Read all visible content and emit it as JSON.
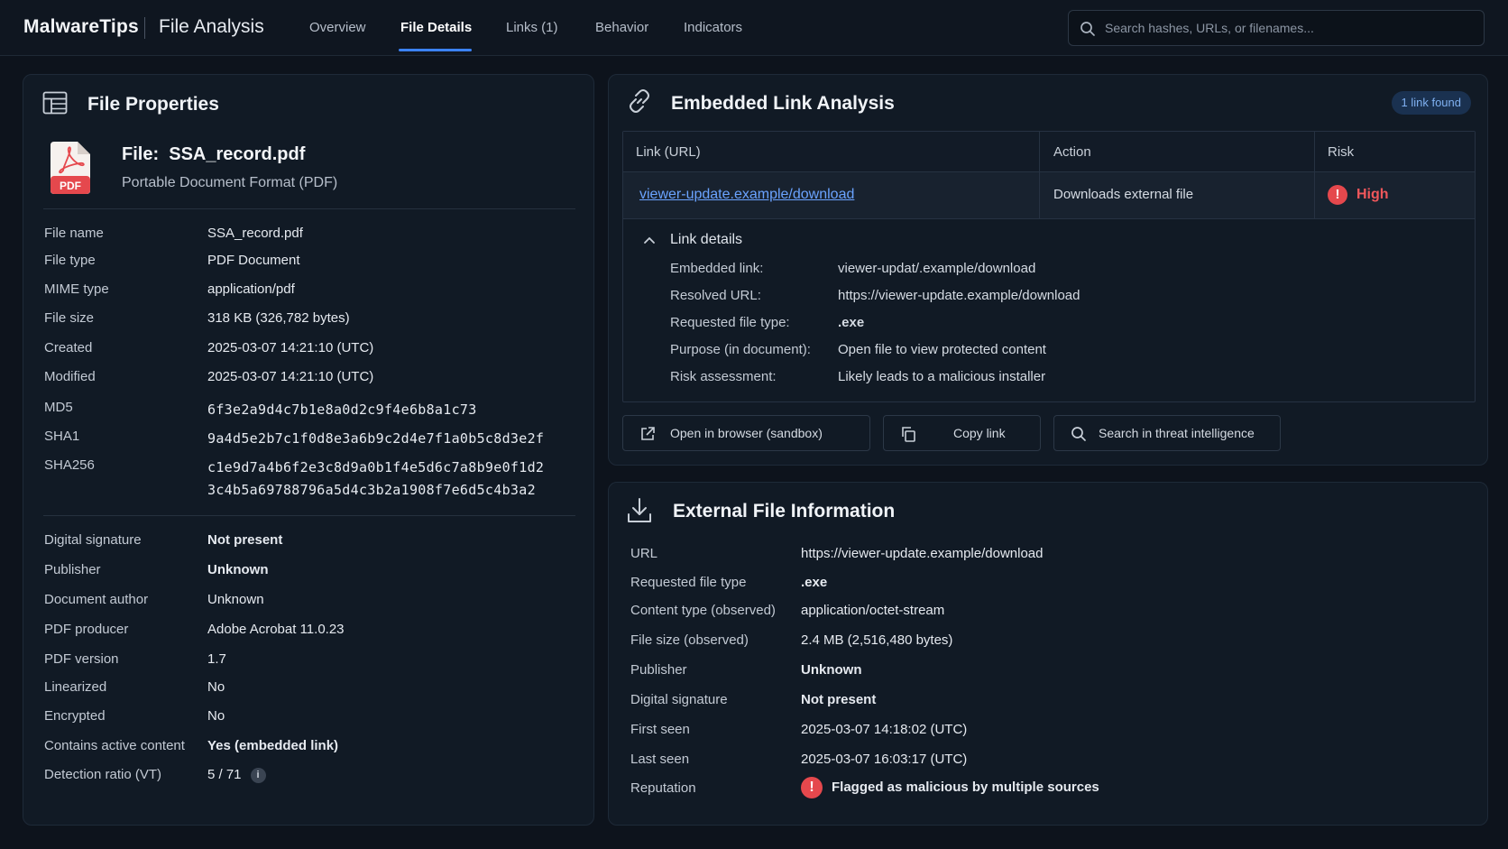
{
  "header": {
    "brand": "MalwareTips",
    "section": "File Analysis",
    "tabs": [
      "Overview",
      "File Details",
      "Links (1)",
      "Behavior",
      "Indicators"
    ],
    "active_tab": "File Details",
    "search_placeholder": "Search hashes, URLs, or filenames..."
  },
  "file_properties": {
    "title": "File Properties",
    "file_label": "File:",
    "file_name": "SSA_record.pdf",
    "file_format": "Portable Document Format (PDF)",
    "pdf_icon_text": "PDF",
    "rows": [
      {
        "label": "File name",
        "value": "SSA_record.pdf"
      },
      {
        "label": "File type",
        "value": "PDF Document"
      },
      {
        "label": "MIME type",
        "value": "application/pdf"
      },
      {
        "label": "File size",
        "value": "318 KB (326,782 bytes)"
      },
      {
        "label": "Created",
        "value": "2025-03-07 14:21:10 (UTC)"
      },
      {
        "label": "Modified",
        "value": "2025-03-07 14:21:10 (UTC)"
      }
    ],
    "hashes": [
      {
        "label": "MD5",
        "value": "6f3e2a9d4c7b1e8a0d2c9f4e6b8a1c73"
      },
      {
        "label": "SHA1",
        "value": "9a4d5e2b7c1f0d8e3a6b9c2d4e7f1a0b5c8d3e2f"
      },
      {
        "label": "SHA256",
        "value_line1": "c1e9d7a4b6f2e3c8d9a0b1f4e5d6c7a8b9e0f1d2",
        "value_line2": "3c4b5a69788796a5d4c3b2a1908f7e6d5c4b3a2"
      }
    ],
    "meta": [
      {
        "label": "Digital signature",
        "value": "Not present"
      },
      {
        "label": "Publisher",
        "value": "Unknown"
      },
      {
        "label": "Document author",
        "value": "Unknown"
      },
      {
        "label": "PDF producer",
        "value": "Adobe Acrobat 11.0.23"
      },
      {
        "label": "PDF version",
        "value": "1.7"
      },
      {
        "label": "Linearized",
        "value": "No"
      },
      {
        "label": "Encrypted",
        "value": "No"
      },
      {
        "label": "Contains active content",
        "value": "Yes (embedded link)"
      },
      {
        "label": "Detection ratio (VT)",
        "value": "5 / 71"
      }
    ],
    "info_glyph": "i"
  },
  "link_analysis": {
    "title": "Embedded Link Analysis",
    "badge": "1 link found",
    "columns": [
      "Link (URL)",
      "Action",
      "Risk"
    ],
    "link": {
      "url": "viewer-update.example/download",
      "action": "Downloads external file",
      "risk": "High",
      "risk_glyph": "!"
    },
    "details_header": "Link details",
    "details": [
      {
        "label": "Embedded link:",
        "value": "viewer-updat/.example/download"
      },
      {
        "label": "Resolved URL:",
        "value": "https://viewer-update.example/download"
      },
      {
        "label": "Requested file type:",
        "value": ".exe"
      },
      {
        "label": "Purpose (in document):",
        "value": "Open file to view protected content"
      },
      {
        "label": "Risk assessment:",
        "value": "Likely leads to a malicious installer"
      }
    ],
    "buttons": [
      "Open in browser (sandbox)",
      "Copy link",
      "Search in threat intelligence"
    ]
  },
  "external_file": {
    "title": "External File Information",
    "rows": [
      {
        "label": "URL",
        "value": "https://viewer-update.example/download"
      },
      {
        "label": "Requested file type",
        "value": ".exe"
      },
      {
        "label": "Content type (observed)",
        "value": "application/octet-stream"
      },
      {
        "label": "File size (observed)",
        "value": "2.4 MB (2,516,480 bytes)"
      },
      {
        "label": "Publisher",
        "value": "Unknown"
      },
      {
        "label": "Digital signature",
        "value": "Not present"
      },
      {
        "label": "First seen",
        "value": "2025-03-07 14:18:02 (UTC)"
      },
      {
        "label": "Last seen",
        "value": "2025-03-07 16:03:17 (UTC)"
      },
      {
        "label": "Reputation",
        "value": "Flagged as malicious by multiple sources"
      }
    ],
    "reputation_glyph": "!"
  },
  "colors": {
    "background": "#0d131c",
    "panel": "#111a25",
    "accent": "#3b82f6",
    "danger": "#f0575b",
    "link": "#6aa3ff"
  }
}
